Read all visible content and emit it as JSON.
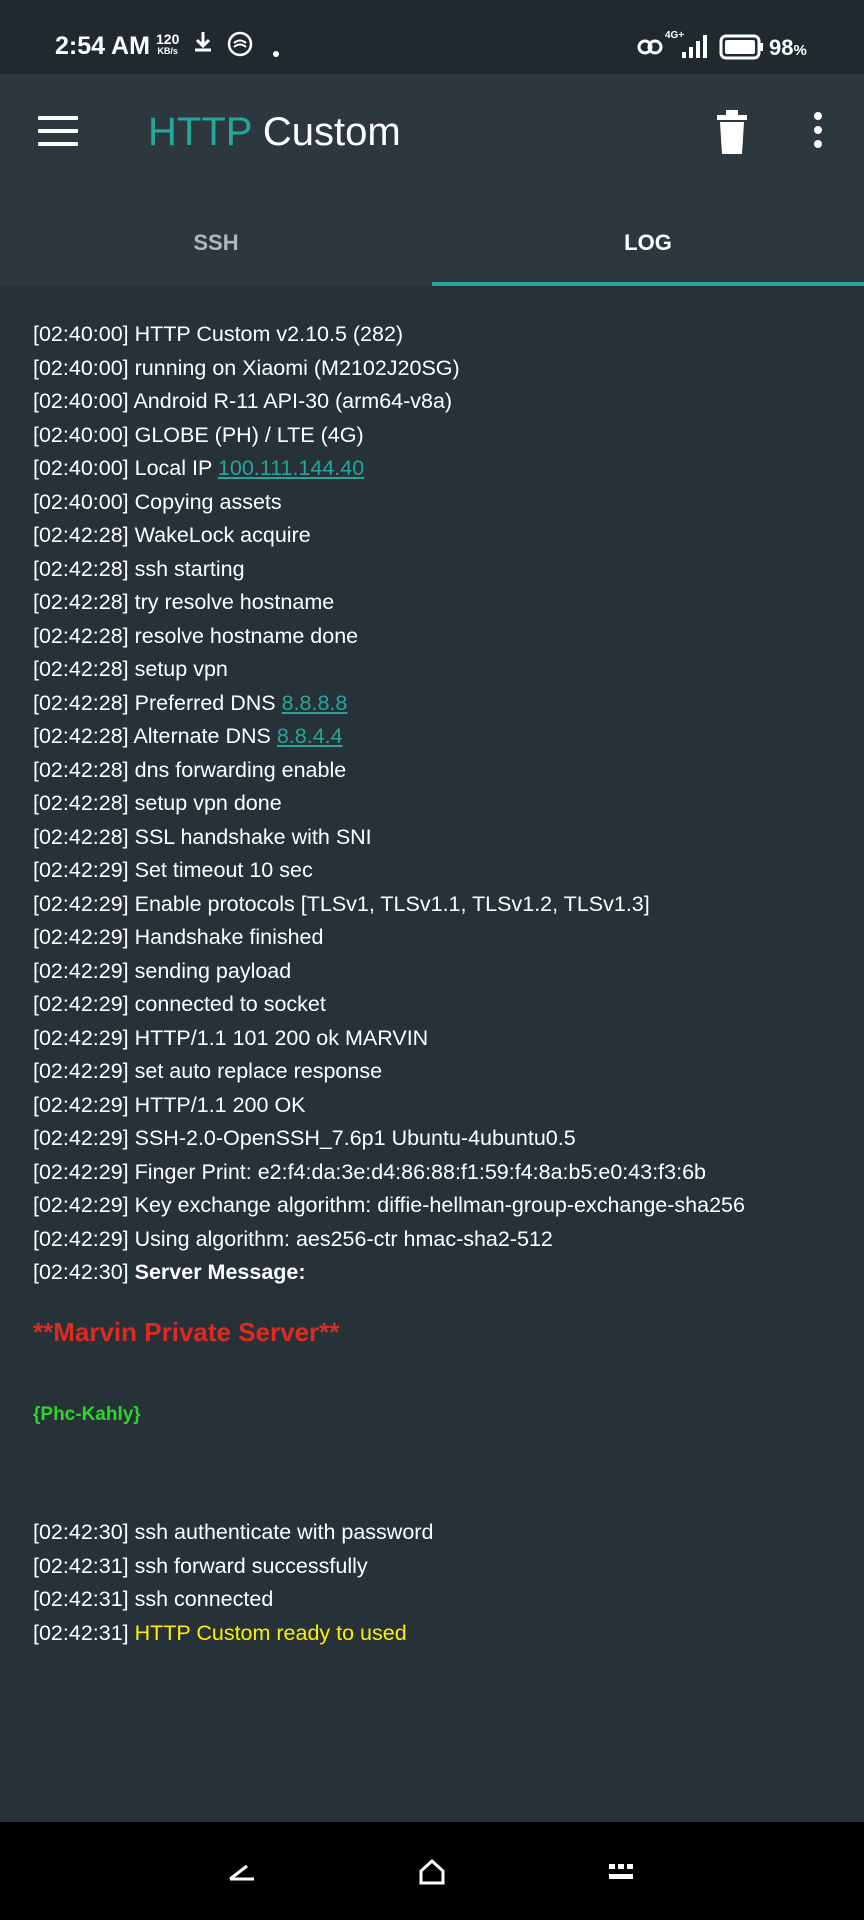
{
  "status_bar": {
    "time": "2:54 AM",
    "speed_value": "120",
    "speed_unit": "KB/s",
    "network": "4G+",
    "battery_value": "98",
    "battery_unit": "%"
  },
  "app_bar": {
    "title_part1": "HTTP",
    "title_part2": "Custom"
  },
  "tabs": [
    {
      "label": "SSH",
      "active": false
    },
    {
      "label": "LOG",
      "active": true
    }
  ],
  "log": {
    "lines": [
      {
        "ts": "[02:40:00]",
        "text": "HTTP Custom v2.10.5 (282)"
      },
      {
        "ts": "[02:40:00]",
        "text": "running on Xiaomi (M2102J20SG)"
      },
      {
        "ts": "[02:40:00]",
        "text": "Android R-11 API-30 (arm64-v8a)"
      },
      {
        "ts": "[02:40:00]",
        "text": "GLOBE (PH) / LTE (4G)"
      },
      {
        "ts": "[02:40:00]",
        "text": "Local IP",
        "link": "100.111.144.40"
      },
      {
        "ts": "[02:40:00]",
        "text": "Copying assets"
      },
      {
        "ts": "[02:42:28]",
        "text": "WakeLock acquire"
      },
      {
        "ts": "[02:42:28]",
        "text": "ssh starting"
      },
      {
        "ts": "[02:42:28]",
        "text": "try resolve hostname"
      },
      {
        "ts": "[02:42:28]",
        "text": "resolve hostname done"
      },
      {
        "ts": "[02:42:28]",
        "text": "setup vpn"
      },
      {
        "ts": "[02:42:28]",
        "text": "Preferred DNS",
        "link": "8.8.8.8"
      },
      {
        "ts": "[02:42:28]",
        "text": "Alternate DNS",
        "link": "8.8.4.4"
      },
      {
        "ts": "[02:42:28]",
        "text": "dns forwarding enable"
      },
      {
        "ts": "[02:42:28]",
        "text": "setup vpn done"
      },
      {
        "ts": "[02:42:28]",
        "text": "SSL handshake with SNI"
      },
      {
        "ts": "[02:42:29]",
        "text": "Set timeout 10 sec"
      },
      {
        "ts": "[02:42:29]",
        "text": "Enable protocols [TLSv1, TLSv1.1, TLSv1.2, TLSv1.3]"
      },
      {
        "ts": "[02:42:29]",
        "text": "Handshake finished"
      },
      {
        "ts": "[02:42:29]",
        "text": "sending payload"
      },
      {
        "ts": "[02:42:29]",
        "text": "connected to socket"
      },
      {
        "ts": "[02:42:29]",
        "text": "HTTP/1.1 101 200 ok MARVIN"
      },
      {
        "ts": "[02:42:29]",
        "text": "set auto replace response"
      },
      {
        "ts": "[02:42:29]",
        "text": "HTTP/1.1 200 OK"
      },
      {
        "ts": "[02:42:29]",
        "text": "SSH-2.0-OpenSSH_7.6p1 Ubuntu-4ubuntu0.5"
      },
      {
        "ts": "[02:42:29]",
        "text": "Finger Print: e2:f4:da:3e:d4:86:88:f1:59:f4:8a:b5:e0:43:f3:6b"
      },
      {
        "ts": "[02:42:29]",
        "text": "Key exchange algorithm: diffie-hellman-group-exchange-sha256"
      },
      {
        "ts": "[02:42:29]",
        "text": "Using algorithm: aes256-ctr hmac-sha2-512"
      },
      {
        "ts": "[02:42:30]",
        "text": "Server Message:",
        "bold": true
      }
    ],
    "server_message": "**Marvin Private Server**",
    "server_sub": "{Phc-Kahly}",
    "lines_after": [
      {
        "ts": "[02:42:30]",
        "text": "ssh authenticate with password"
      },
      {
        "ts": "[02:42:31]",
        "text": "ssh forward successfully"
      },
      {
        "ts": "[02:42:31]",
        "text": "ssh connected"
      },
      {
        "ts": "[02:42:31]",
        "text": "HTTP Custom ready to used",
        "yellow": true
      }
    ]
  },
  "colors": {
    "accent": "#26a69a",
    "background": "#263238",
    "appbar": "#2d383e",
    "server_message": "#e12a1f",
    "server_sub": "#2ed62a",
    "ready": "#ffee00"
  },
  "icons": {
    "menu": "hamburger-menu-icon",
    "delete": "trash-icon",
    "more": "more-vertical-icon",
    "nav_back": "back-icon",
    "nav_home": "home-icon",
    "nav_recents": "recents-icon"
  }
}
